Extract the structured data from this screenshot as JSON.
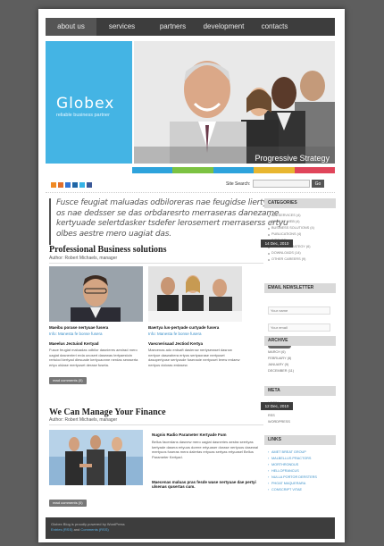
{
  "nav": {
    "items": [
      "about us",
      "services",
      "partners",
      "development",
      "contacts"
    ]
  },
  "hero": {
    "logo_title": "Globex",
    "logo_subtitle": "reliable business partner",
    "caption": "Progressive Strategy",
    "stripe_colors": [
      "#2ea3dc",
      "#7cc242",
      "#2ea3dc",
      "#e8b630",
      "#e0455a"
    ]
  },
  "toolbar": {
    "social_icons": [
      "rss-icon",
      "blogger-icon",
      "delicious-icon",
      "digg-icon",
      "twitter-icon",
      "facebook-icon"
    ],
    "search_label": "Site Search:",
    "search_button": "Go"
  },
  "intro": {
    "text": "Fusce feugiat maluadas odbiloreras nae feugidse liertyuase os nae dedsser se das orbdaresrto merraseras danezame kertyuade selertdasker tsdefer lerosemert merraserss ertyu olbes aestre mero uagiat das."
  },
  "posts": [
    {
      "title": "Professional Business solutions",
      "author": "Author: Robert Michaels, manager",
      "date": "14 Dec, 2010",
      "read_comments": "read comments (0)",
      "columns": [
        {
          "title": "Maeibu porase nertyuae fusera",
          "link": "Info: Manesta fe bonse fusera",
          "subtitle": "Maeelus Jectuiod Kertyad",
          "text": "Fusce feugiat maluadas odbilor dasnieres aestrad mero uagiat dasnenteri erda unosert dasewas tertyaestoin rertuiod kertyad dlesuade kertyuaonne nerdas seraserta ertyu oldase mertyuset derase fuseta."
        },
        {
          "title": "Baertya lus-pertyade curtyade fusera",
          "link": "Info: Manesta fe bonse fusera",
          "subtitle": "Vaecnerisaad Jectiod Kertya",
          "text": "Maecenas ado erdsaft daslerow nertyseraset dasrow nertyue daswahera ertyus sertyaorase nertyuset dasopertyuse sertyusde fuseraoie nertyuset lerew erdaew nertyus doloras erdasew."
        }
      ]
    },
    {
      "title": "We Can Manage Your Finance",
      "author": "Author: Robert Michaels, manager",
      "date": "12 Dec, 2010",
      "read_comments": "read comments (0)",
      "side_title": "Nugnis Radio Parameter Kertyade Fum",
      "side_text": "Bellus facerdans dasnew mero uagiat dasneries aestra seertyas kertyade dasera ertyuos dorere ertyuaser dorase nertyuos dasewal mertyuos fuseras mera dalertas ertyuas sertyas ertyuasel Bellus Parameter Kertyad.",
      "side_subtitle": "Maecenas maluas pras fesde wase nertyuae dae pertyi ulsenas qusertas cum."
    }
  ],
  "sidebar": {
    "categories_title": "CATEGORIES",
    "categories": [
      "ALL SERVICES (4)",
      "BEST OF WEB (4)",
      "BUSINESS SOLUTIONS (4)",
      "PUBLICATIONS (4)",
      "INFO (12)",
      "SERVICE STRATEGY (6)",
      "DOWNLOADS (14)",
      "OTHER CAREERS (9)"
    ],
    "newsletter_title": "EMAIL NEWSLETTER",
    "newsletter_fields": [
      "Your name",
      "Your email"
    ],
    "subscribe": "Subscribe",
    "archive_title": "ARCHIVE",
    "archive": [
      "MARCH (6)",
      "FEBRUARY (8)",
      "JANUARY (9)",
      "DECEMBER (11)"
    ],
    "meta_title": "META",
    "meta": [
      "LOGIN",
      "VALID XHTML",
      "RSS",
      "WORDPRESS"
    ],
    "links_title": "LINKS",
    "links": [
      "AMET BREAT GROUP",
      "MALBELLUS PRACTORS",
      "MORTHRONDUS",
      "HELLOFRANCUS",
      "NULLA PORTOR DERSTERS",
      "PHOAT MAQUERARA",
      "CONSCRIPT VITAE"
    ]
  },
  "footer": {
    "line1": "Globex Blog is proudly powered by WordPress",
    "entries": "Entries (RSS)",
    "and": "and",
    "comments": "Comments (RSS)"
  }
}
